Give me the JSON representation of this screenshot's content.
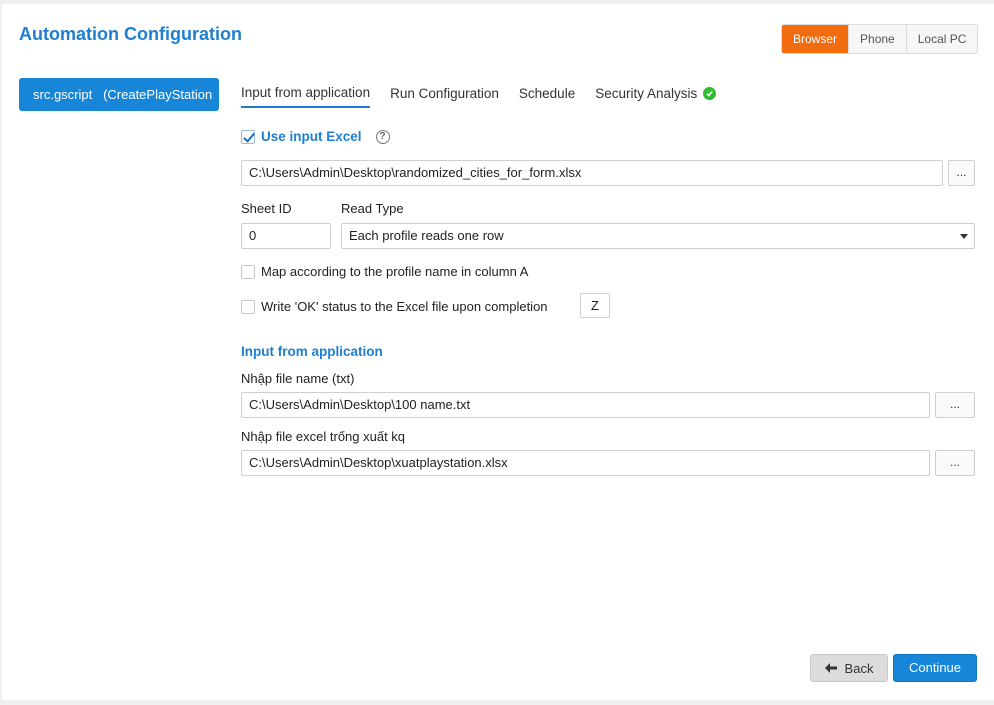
{
  "header": {
    "title": "Automation Configuration",
    "modes": [
      {
        "label": "Browser",
        "active": true
      },
      {
        "label": "Phone",
        "active": false
      },
      {
        "label": "Local PC",
        "active": false
      }
    ]
  },
  "sidebar": {
    "script_label": "src.gscript   (CreatePlayStation"
  },
  "tabs": [
    {
      "label": "Input from application"
    },
    {
      "label": "Run Configuration"
    },
    {
      "label": "Schedule"
    },
    {
      "label": "Security Analysis"
    }
  ],
  "excel": {
    "use_input_label": "Use input Excel",
    "use_input_checked": true,
    "help_glyph": "?",
    "file_path": "C:\\Users\\Admin\\Desktop\\randomized_cities_for_form.xlsx",
    "browse_label": "...",
    "sheet_id_label": "Sheet ID",
    "sheet_id_value": "0",
    "read_type_label": "Read Type",
    "read_type_value": "Each profile reads one row",
    "map_label": "Map according to the profile name in column A",
    "write_ok_label": "Write 'OK' status to the Excel file upon completion",
    "write_ok_column": "Z"
  },
  "app_input": {
    "section_title": "Input from application",
    "name_file_label": "Nhập file name (txt)",
    "name_file_path": "C:\\Users\\Admin\\Desktop\\100 name.txt",
    "excel_out_label": "Nhập file excel trống xuất kq",
    "excel_out_path": "C:\\Users\\Admin\\Desktop\\xuatplaystation.xlsx",
    "browse_label": "..."
  },
  "footer": {
    "back_label": "Back",
    "continue_label": "Continue"
  },
  "colors": {
    "accent": "#1e7fd0",
    "active_mode": "#f26b0f",
    "success": "#2dbd2d"
  }
}
